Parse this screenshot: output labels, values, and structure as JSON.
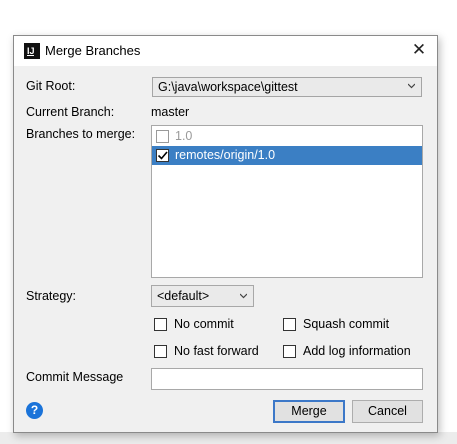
{
  "dialog": {
    "title": "Merge Branches",
    "app_icon_text": "IJ",
    "close_glyph": "✕",
    "git_root_label": "Git Root:",
    "git_root_value": "G:\\java\\workspace\\gittest",
    "current_branch_label": "Current Branch:",
    "current_branch_value": "master",
    "branches_label": "Branches to merge:",
    "branches": [
      {
        "label": "1.0",
        "checked": false,
        "selected": false
      },
      {
        "label": "remotes/origin/1.0",
        "checked": true,
        "selected": true
      }
    ],
    "strategy_label": "Strategy:",
    "strategy_value": "<default>",
    "options": {
      "no_commit": "No commit",
      "squash_commit": "Squash commit",
      "no_fast_forward": "No fast forward",
      "add_log_information": "Add log information"
    },
    "commit_message_label": "Commit Message",
    "commit_message_value": "",
    "help_glyph": "?",
    "merge_button": "Merge",
    "cancel_button": "Cancel"
  },
  "colors": {
    "selection": "#3b7fc4",
    "primary_button_border": "#3c78c8",
    "help_icon": "#1a73d9"
  }
}
